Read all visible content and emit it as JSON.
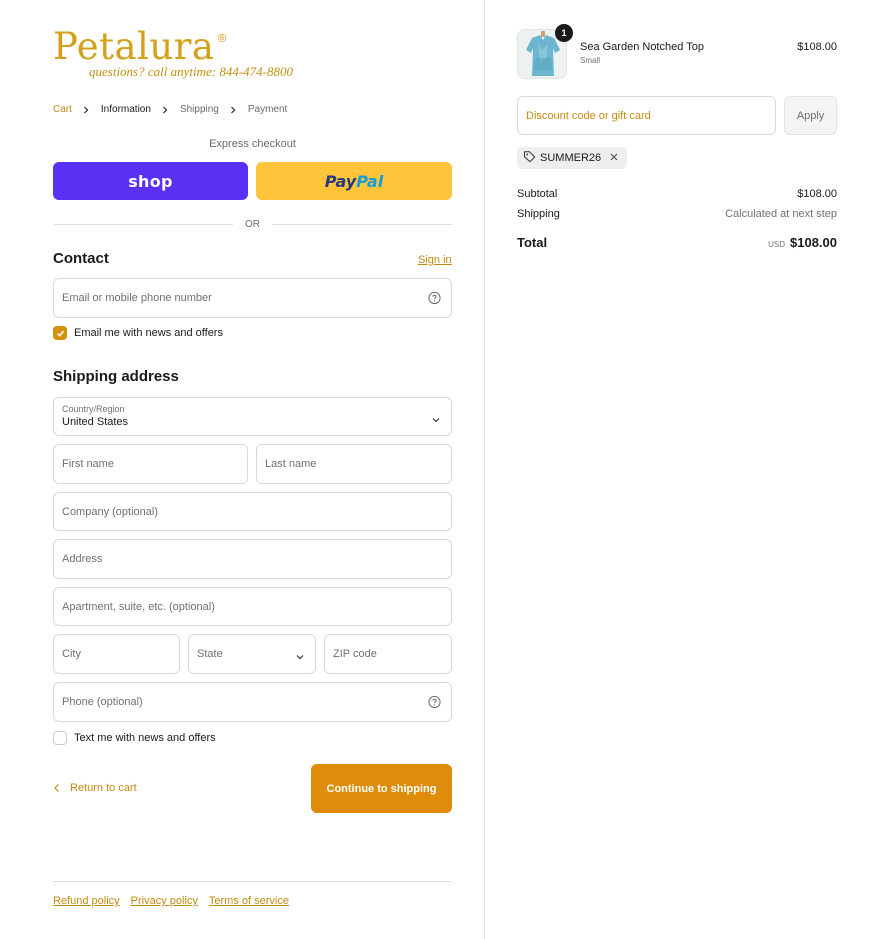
{
  "brand": {
    "name": "Petalura",
    "registered_mark": "®",
    "tagline": "questions? call anytime: 844-474-8800",
    "color": "#d4a017"
  },
  "breadcrumb": {
    "cart": "Cart",
    "information": "Information",
    "shipping": "Shipping",
    "payment": "Payment"
  },
  "express": {
    "label": "Express checkout",
    "shop_label": "shop",
    "paypal_part1": "Pay",
    "paypal_part2": "Pal",
    "or": "OR"
  },
  "contact": {
    "title": "Contact",
    "sign_in": "Sign in",
    "email_placeholder": "Email or mobile phone number",
    "email_optin": "Email me with news and offers",
    "email_optin_checked": true
  },
  "shipping": {
    "title": "Shipping address",
    "country_label": "Country/Region",
    "country_value": "United States",
    "first_name": "First name",
    "last_name": "Last name",
    "company": "Company (optional)",
    "address": "Address",
    "apartment": "Apartment, suite, etc. (optional)",
    "city": "City",
    "state": "State",
    "zip": "ZIP code",
    "phone": "Phone (optional)",
    "text_optin": "Text me with news and offers",
    "text_optin_checked": false
  },
  "actions": {
    "return": "Return to cart",
    "continue": "Continue to shipping"
  },
  "footer": {
    "refund": "Refund policy",
    "privacy": "Privacy policy",
    "terms": "Terms of service"
  },
  "order": {
    "item": {
      "name": "Sea Garden Notched Top",
      "variant": "Small",
      "price": "$108.00",
      "quantity": "1"
    },
    "discount_placeholder": "Discount code or gift card",
    "apply": "Apply",
    "applied_code": "SUMMER26",
    "subtotal_label": "Subtotal",
    "subtotal_value": "$108.00",
    "shipping_label": "Shipping",
    "shipping_value": "Calculated at next step",
    "total_label": "Total",
    "total_currency": "USD",
    "total_value": "$108.00"
  },
  "colors": {
    "accent": "#de8c0a",
    "link": "#c48a10",
    "shop_pay": "#5a31f4",
    "paypal": "#ffc439"
  }
}
